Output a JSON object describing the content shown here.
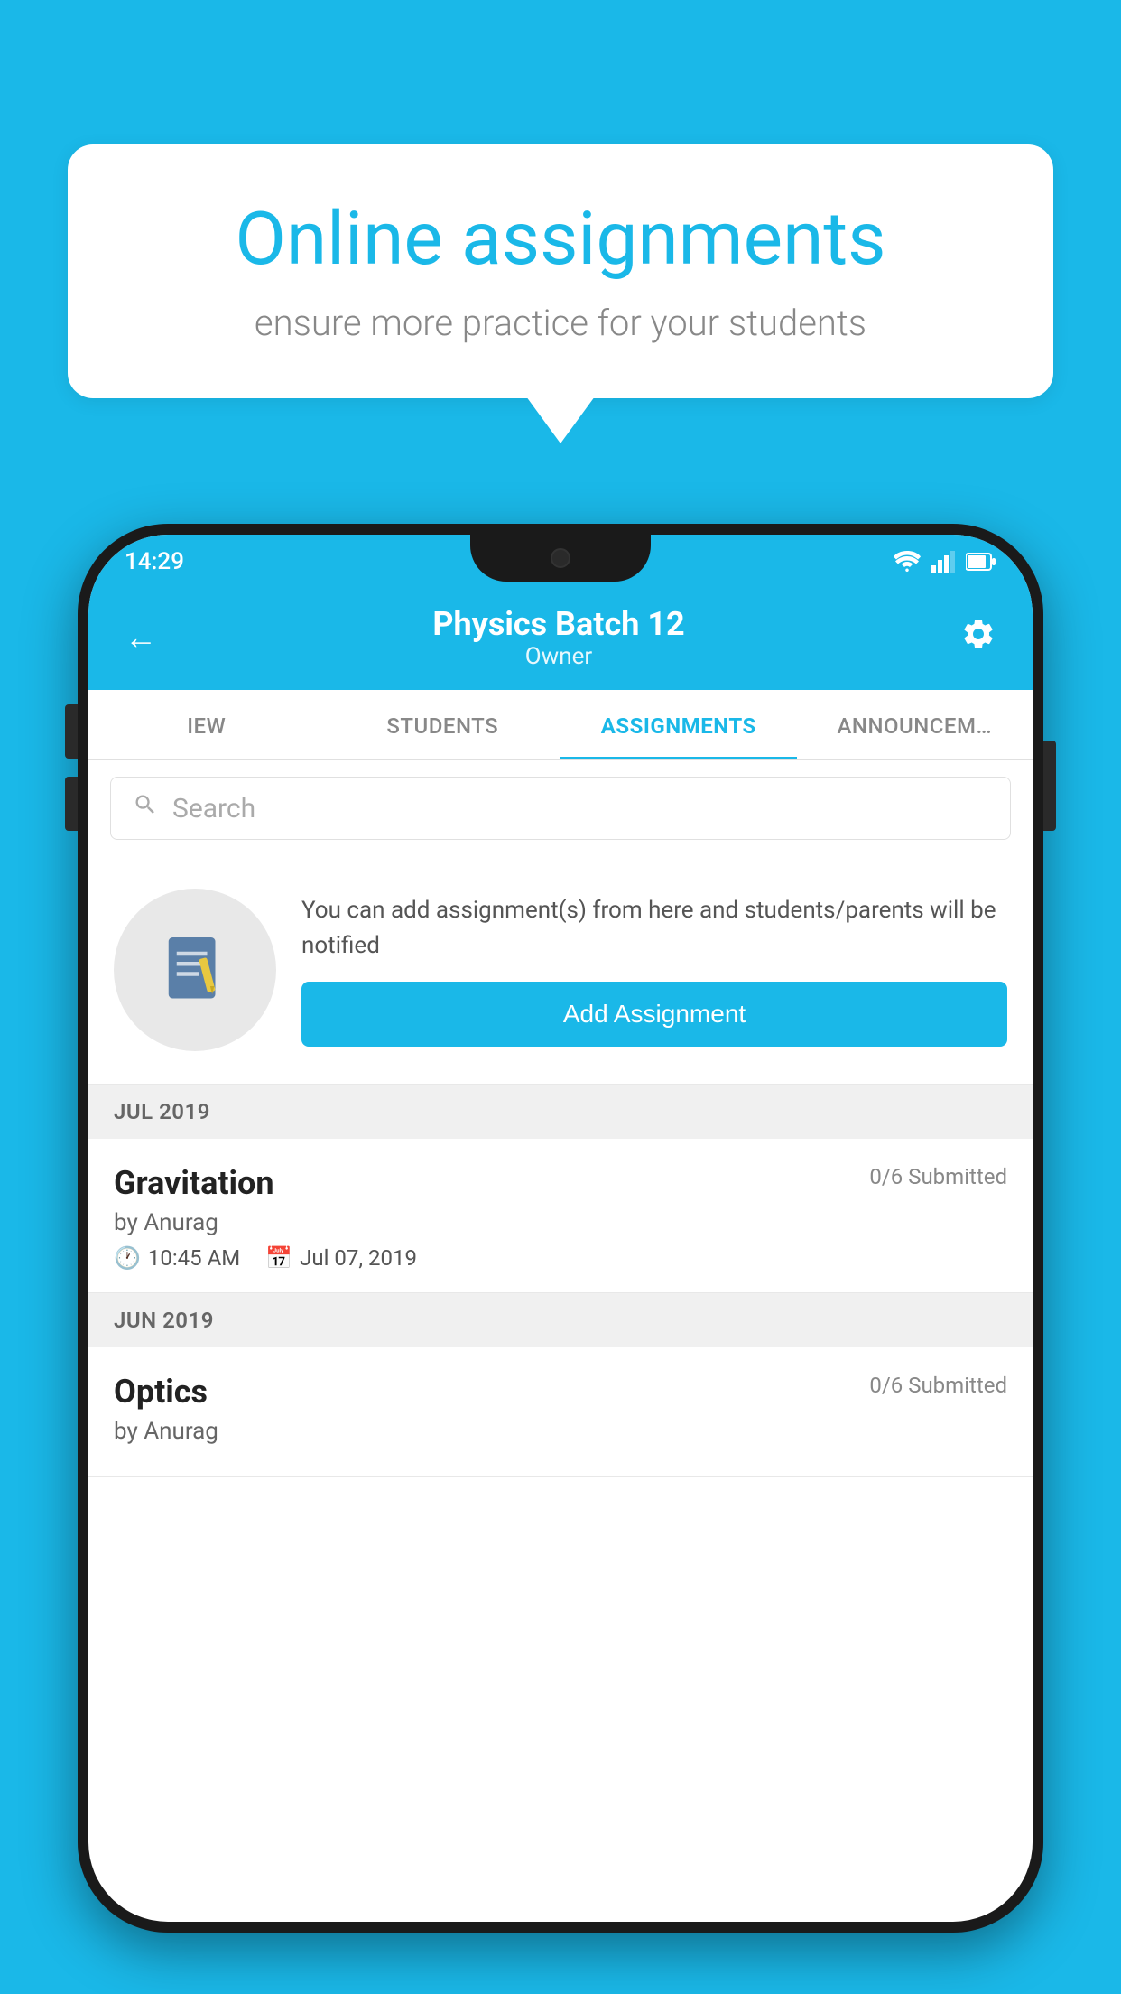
{
  "background_color": "#1ab8e8",
  "speech_bubble": {
    "title": "Online assignments",
    "subtitle": "ensure more practice for your students"
  },
  "status_bar": {
    "time": "14:29"
  },
  "header": {
    "title": "Physics Batch 12",
    "subtitle": "Owner",
    "back_label": "←",
    "settings_label": "⚙"
  },
  "tabs": [
    {
      "label": "IEW",
      "active": false
    },
    {
      "label": "STUDENTS",
      "active": false
    },
    {
      "label": "ASSIGNMENTS",
      "active": true
    },
    {
      "label": "ANNOUNCEM…",
      "active": false
    }
  ],
  "search": {
    "placeholder": "Search"
  },
  "promo": {
    "text": "You can add assignment(s) from here and students/parents will be notified",
    "button_label": "Add Assignment"
  },
  "sections": [
    {
      "label": "JUL 2019",
      "assignments": [
        {
          "name": "Gravitation",
          "submitted": "0/6 Submitted",
          "by": "by Anurag",
          "time": "10:45 AM",
          "date": "Jul 07, 2019"
        }
      ]
    },
    {
      "label": "JUN 2019",
      "assignments": [
        {
          "name": "Optics",
          "submitted": "0/6 Submitted",
          "by": "by Anurag",
          "time": "",
          "date": ""
        }
      ]
    }
  ]
}
